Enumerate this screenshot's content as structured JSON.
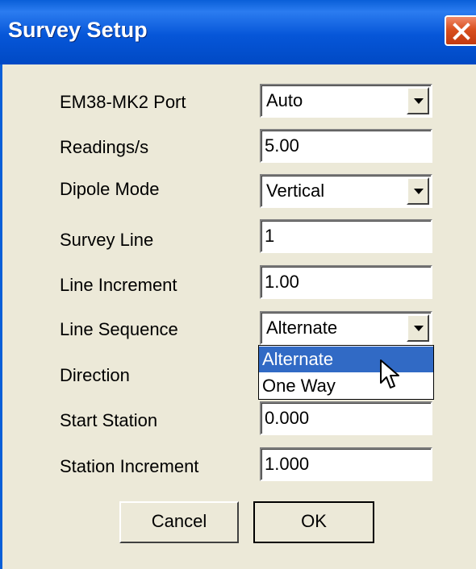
{
  "window": {
    "title": "Survey Setup"
  },
  "fields": {
    "port": {
      "label": "EM38-MK2 Port",
      "value": "Auto"
    },
    "readings": {
      "label": "Readings/s",
      "value": "5.00"
    },
    "dipole": {
      "label": "Dipole Mode",
      "value": "Vertical"
    },
    "survey_line": {
      "label": "Survey Line",
      "value": "1"
    },
    "line_increment": {
      "label": "Line Increment",
      "value": "1.00"
    },
    "line_sequence": {
      "label": "Line Sequence",
      "value": "Alternate"
    },
    "direction": {
      "label": "Direction"
    },
    "start_station": {
      "label": "Start Station",
      "value": "0.000"
    },
    "station_increment": {
      "label": "Station Increment",
      "value": "1.000"
    }
  },
  "dropdown": {
    "options": [
      "Alternate",
      "One Way"
    ],
    "selected": "Alternate"
  },
  "buttons": {
    "cancel": "Cancel",
    "ok": "OK"
  },
  "colors": {
    "titlebar": "#0a5fd8",
    "selection": "#316ac5",
    "dialog_bg": "#ece9d8",
    "close": "#d9501f"
  },
  "icons": {
    "close": "close-x-icon",
    "dropdown": "chevron-down-icon",
    "cursor": "mouse-pointer-icon"
  }
}
